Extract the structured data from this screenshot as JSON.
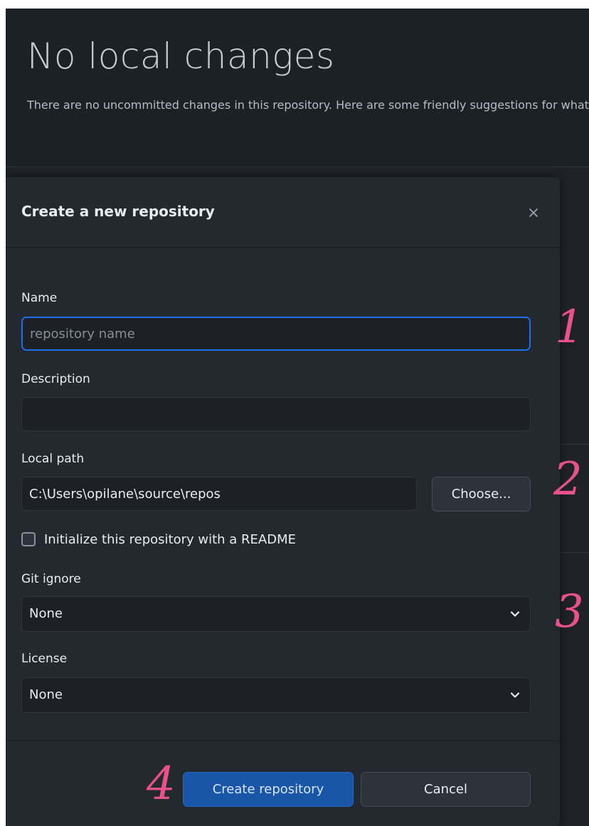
{
  "page": {
    "title": "No local changes",
    "subtitle": "There are no uncommitted changes in this repository. Here are some friendly suggestions for what to do next."
  },
  "dialog": {
    "title": "Create a new repository",
    "close_icon": "close-icon",
    "name": {
      "label": "Name",
      "value": "",
      "placeholder": "repository name"
    },
    "description": {
      "label": "Description",
      "value": ""
    },
    "local_path": {
      "label": "Local path",
      "value": "C:\\Users\\opilane\\source\\repos",
      "choose_label": "Choose..."
    },
    "readme": {
      "label": "Initialize this repository with a README",
      "checked": false
    },
    "git_ignore": {
      "label": "Git ignore",
      "selected": "None"
    },
    "license": {
      "label": "License",
      "selected": "None"
    },
    "create_label": "Create repository",
    "cancel_label": "Cancel"
  },
  "annotations": [
    "1",
    "2",
    "3",
    "4"
  ],
  "colors": {
    "background": "#1f2328",
    "dialog": "#24292f",
    "primary_button": "#1a56a8",
    "focus_border": "#1f6feb",
    "annotation_ink": "#e8508e"
  }
}
